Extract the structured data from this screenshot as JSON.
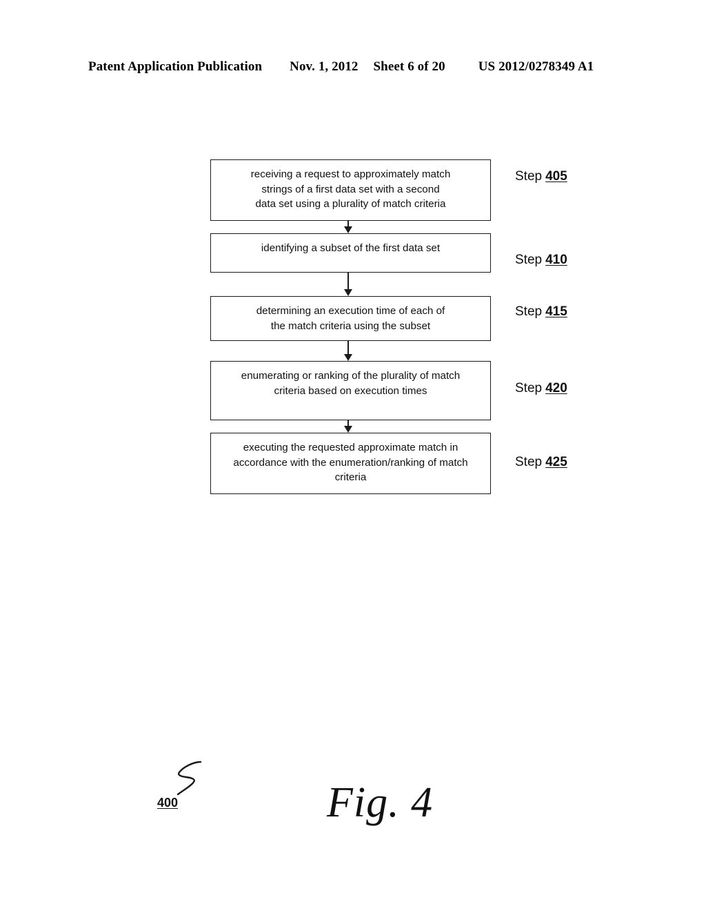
{
  "header": {
    "publication": "Patent Application Publication",
    "date": "Nov. 1, 2012",
    "sheet": "Sheet 6 of 20",
    "patent_number": "US 2012/0278349 A1"
  },
  "figure": {
    "caption": "Fig. 4",
    "reference_number": "400",
    "leader_icon": "squiggle-leader-icon"
  },
  "flowchart": {
    "step_word": "Step",
    "steps": [
      {
        "id": "405",
        "number": "405",
        "text": "receiving a request to approximately match\nstrings of a first data set with a second\ndata set using a plurality of match criteria"
      },
      {
        "id": "410",
        "number": "410",
        "text": "identifying a subset of the first data set"
      },
      {
        "id": "415",
        "number": "415",
        "text": "determining an execution time of each of\nthe match criteria using the subset"
      },
      {
        "id": "420",
        "number": "420",
        "text": "enumerating or ranking of the plurality of match\ncriteria based on execution times"
      },
      {
        "id": "425",
        "number": "425",
        "text": "executing the requested approximate match in\naccordance with the enumeration/ranking of match\ncriteria"
      }
    ],
    "connectors": [
      {
        "from": "405",
        "to": "410",
        "icon": "down-arrow-icon"
      },
      {
        "from": "410",
        "to": "415",
        "icon": "down-arrow-icon"
      },
      {
        "from": "415",
        "to": "420",
        "icon": "down-arrow-icon"
      },
      {
        "from": "420",
        "to": "425",
        "icon": "down-arrow-icon"
      }
    ]
  },
  "colors": {
    "ink": "#1a1a1a",
    "page_background": "#ffffff"
  }
}
